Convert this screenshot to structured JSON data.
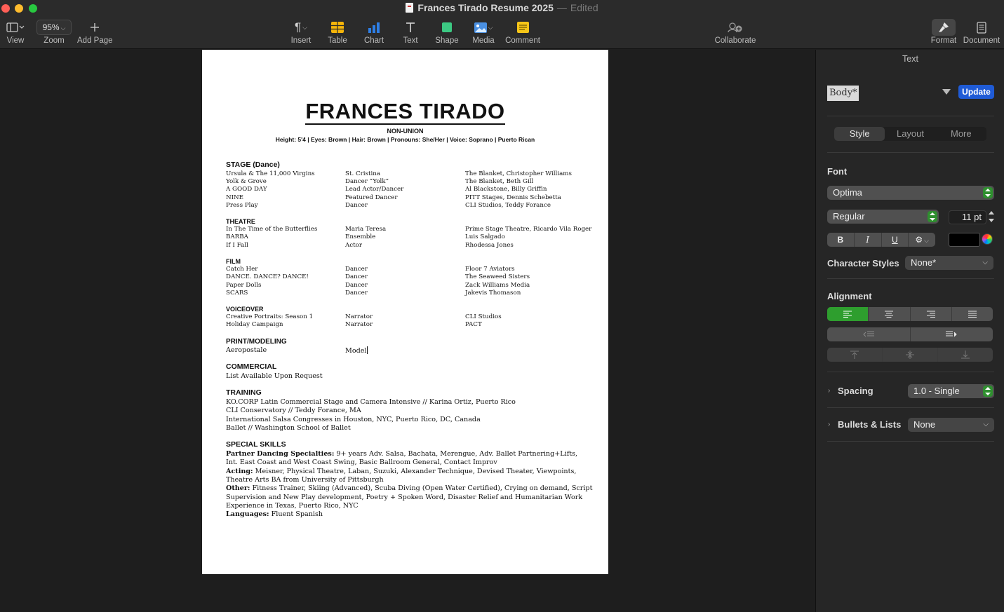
{
  "window": {
    "doc_title": "Frances Tirado Resume 2025",
    "separator": "—",
    "status": "Edited"
  },
  "toolbar": {
    "view": "View",
    "zoom_value": "95%",
    "zoom": "Zoom",
    "add_page": "Add Page",
    "insert": "Insert",
    "table": "Table",
    "chart": "Chart",
    "text": "Text",
    "shape": "Shape",
    "media": "Media",
    "comment": "Comment",
    "collaborate": "Collaborate",
    "format": "Format",
    "document": "Document"
  },
  "resume": {
    "name": "FRANCES TIRADO",
    "union": "NON-UNION",
    "stats": "Height: 5'4 | Eyes: Brown | Hair: Brown | Pronouns: She/Her | Voice: Soprano | Puerto Rican",
    "stage_heading": "STAGE (Dance)",
    "stage": [
      [
        "Ursula & The 11,000 Virgins",
        "St. Cristina",
        "The Blanket, Christopher Williams"
      ],
      [
        "Yolk & Grove",
        "Dancer “Yolk”",
        "The Blanket, Beth Gill"
      ],
      [
        "A GOOD DAY",
        "Lead Actor/Dancer",
        "Al Blackstone, Billy Griffin"
      ],
      [
        "NINE",
        "Featured Dancer",
        "PITT Stages, Dennis Schebetta"
      ],
      [
        "Press Play",
        "Dancer",
        "CLI Studios, Teddy Forance"
      ]
    ],
    "theatre_heading": "THEATRE",
    "theatre": [
      [
        "In The Time of the Butterflies",
        "Maria Teresa",
        "Prime Stage Theatre, Ricardo Vila Roger"
      ],
      [
        "BARBA",
        "Ensemble",
        "Luis Salgado"
      ],
      [
        "If I Fall",
        "Actor",
        "Rhodessa Jones"
      ]
    ],
    "film_heading": "FILM",
    "film": [
      [
        "Catch Her",
        "Dancer",
        "Floor 7 Aviators"
      ],
      [
        "DANCE. DANCE? DANCE!",
        "Dancer",
        "The Seaweed Sisters"
      ],
      [
        "Paper Dolls",
        "Dancer",
        "Zack Williams Media"
      ],
      [
        "SCARS",
        "Dancer",
        "Jakevis Thomason"
      ]
    ],
    "voiceover_heading": "VOICEOVER",
    "voiceover": [
      [
        "Creative Portraits: Season 1",
        "Narrator",
        "CLI Studios"
      ],
      [
        "Holiday Campaign",
        "Narrator",
        "PACT"
      ]
    ],
    "print_heading": "PRINT/MODELING",
    "print": [
      [
        "Aeropostale",
        "Model",
        ""
      ]
    ],
    "commercial_heading": "COMMERCIAL",
    "commercial_line": "List Available Upon Request",
    "training_heading": "TRAINING",
    "training": [
      "KO.CORP Latin Commercial Stage and Camera Intensive // Karina Ortiz, Puerto Rico",
      "CLI Conservatory // Teddy Forance, MA",
      "International Salsa Congresses in Houston, NYC, Puerto Rico, DC, Canada",
      "Ballet // Washington School of Ballet"
    ],
    "skills_heading": "SPECIAL SKILLS",
    "skills": {
      "partner_label": "Partner Dancing Specialties:",
      "partner_1": " 9+ years Adv. Salsa, Bachata, Merengue, Adv. Ballet Partnering+Lifts,",
      "partner_2": "Int. East Coast and West Coast Swing, Basic Ballroom General, Contact Improv",
      "acting_label": "Acting:",
      "acting_1": " Meisner, Physical Theatre, Laban, Suzuki, Alexander Technique, Devised Theater, Viewpoints,",
      "acting_2": "Theatre Arts BA from University of Pittsburgh",
      "other_label": "Other:",
      "other_1": " Fitness Trainer, Skiing (Advanced), Scuba Diving (Open Water Certified), Crying on demand, Script",
      "other_2": "Supervision and New Play development, Poetry + Spoken Word, Disaster Relief and Humanitarian Work",
      "other_3": "Experience in Texas, Puerto Rico, NYC",
      "languages_label": "Languages:",
      "languages": " Fluent Spanish"
    }
  },
  "inspector": {
    "title": "Text",
    "paragraph_style": "Body*",
    "update": "Update",
    "tabs": [
      "Style",
      "Layout",
      "More"
    ],
    "font_label": "Font",
    "font_family": "Optima",
    "font_style": "Regular",
    "font_size": "11 pt",
    "bold": "B",
    "italic": "I",
    "underline": "U",
    "char_styles_label": "Character Styles",
    "char_style": "None*",
    "alignment_label": "Alignment",
    "spacing_label": "Spacing",
    "spacing_value": "1.0 - Single",
    "bullets_label": "Bullets & Lists",
    "bullets_value": "None",
    "colors": {
      "accent": "#2e9e2e",
      "update_button": "#1f5bd6",
      "text_color": "#000000"
    }
  }
}
